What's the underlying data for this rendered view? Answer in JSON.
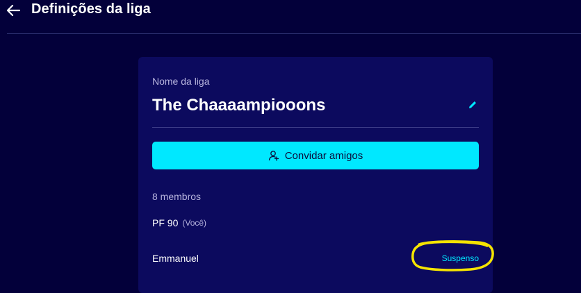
{
  "header": {
    "title": "Definições da liga",
    "back_icon": "arrow-left-icon"
  },
  "league": {
    "name_label": "Nome da liga",
    "name": "The Chaaaampiooons",
    "edit_icon": "pencil-icon"
  },
  "invite": {
    "label": "Convidar amigos",
    "icon": "user-add-icon"
  },
  "members": {
    "count_label": "8 membros",
    "items": [
      {
        "name": "PF 90",
        "tag": "(Você)",
        "status": ""
      },
      {
        "name": "Emmanuel",
        "tag": "",
        "status": "Suspenso"
      }
    ]
  },
  "colors": {
    "background": "#03003a",
    "card": "#0c0a5e",
    "accent": "#00e8ff",
    "highlight": "#f5e400"
  }
}
